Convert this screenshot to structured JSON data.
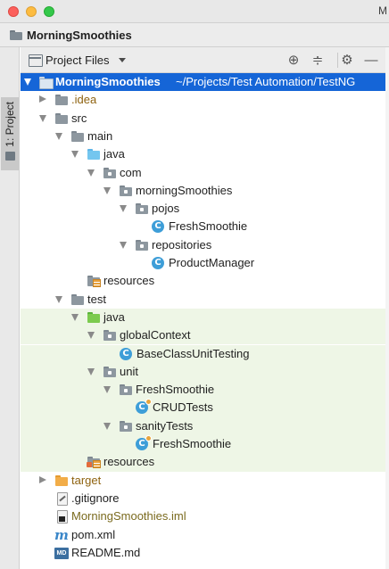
{
  "window": {
    "edge_title_fragment": "M",
    "controls": [
      "close",
      "minimize",
      "zoom"
    ]
  },
  "navigation_bar": {
    "project_name": "MorningSmoothies",
    "icon": "folder-icon"
  },
  "tool_stripe": {
    "tab_label": "1: Project",
    "icon": "project-view-icon"
  },
  "toolbar": {
    "view_label": "Project Files",
    "view_icon": "project-files-icon",
    "buttons": [
      "locate-icon",
      "collapse-all-icon",
      "gear-icon",
      "hide-icon"
    ]
  },
  "tree": {
    "root_name": "MorningSmoothies",
    "root_path": "~/Projects/Test Automation/TestNG",
    "items": [
      {
        "label": "MorningSmoothies",
        "depth": 0,
        "icon": "module-folder-icon",
        "expanded": true
      },
      {
        "label": ".idea",
        "depth": 1,
        "icon": "folder-icon",
        "expanded": false
      },
      {
        "label": "src",
        "depth": 1,
        "icon": "folder-icon",
        "expanded": true
      },
      {
        "label": "main",
        "depth": 2,
        "icon": "folder-icon",
        "expanded": true
      },
      {
        "label": "java",
        "depth": 3,
        "icon": "source-root-folder-icon",
        "expanded": true
      },
      {
        "label": "com",
        "depth": 4,
        "icon": "package-icon",
        "expanded": true
      },
      {
        "label": "morningSmoothies",
        "depth": 5,
        "icon": "package-icon",
        "expanded": true
      },
      {
        "label": "pojos",
        "depth": 6,
        "icon": "package-icon",
        "expanded": true
      },
      {
        "label": "FreshSmoothie",
        "depth": 7,
        "icon": "java-class-icon"
      },
      {
        "label": "repositories",
        "depth": 6,
        "icon": "package-icon",
        "expanded": true
      },
      {
        "label": "ProductManager",
        "depth": 7,
        "icon": "java-class-icon"
      },
      {
        "label": "resources",
        "depth": 4,
        "icon": "resources-folder-icon"
      },
      {
        "label": "test",
        "depth": 2,
        "icon": "folder-icon",
        "expanded": true
      },
      {
        "label": "java",
        "depth": 3,
        "icon": "test-root-folder-icon",
        "expanded": true
      },
      {
        "label": "globalContext",
        "depth": 4,
        "icon": "package-icon",
        "expanded": true
      },
      {
        "label": "BaseClassUnitTesting",
        "depth": 5,
        "icon": "java-class-icon"
      },
      {
        "label": "unit",
        "depth": 4,
        "icon": "package-icon",
        "expanded": true
      },
      {
        "label": "FreshSmoothie",
        "depth": 5,
        "icon": "package-icon",
        "expanded": true
      },
      {
        "label": "CRUDTests",
        "depth": 6,
        "icon": "test-class-icon"
      },
      {
        "label": "sanityTests",
        "depth": 5,
        "icon": "package-icon",
        "expanded": true
      },
      {
        "label": "FreshSmoothie",
        "depth": 6,
        "icon": "test-class-icon"
      },
      {
        "label": "resources",
        "depth": 4,
        "icon": "test-resources-folder-icon"
      },
      {
        "label": "target",
        "depth": 1,
        "icon": "excluded-folder-icon",
        "expanded": false
      },
      {
        "label": ".gitignore",
        "depth": 1,
        "icon": "gitignore-file-icon"
      },
      {
        "label": "MorningSmoothies.iml",
        "depth": 1,
        "icon": "iml-file-icon"
      },
      {
        "label": "pom.xml",
        "depth": 1,
        "icon": "maven-icon"
      },
      {
        "label": "README.md",
        "depth": 1,
        "icon": "markdown-file-icon"
      }
    ]
  },
  "colors": {
    "selection": "#1565d7",
    "test_highlight": "#eef6e6",
    "excluded_text": "#8f6310",
    "class_icon": "#3e9ed8",
    "source_folder": "#74c6ef",
    "test_folder": "#7ccb4e"
  }
}
